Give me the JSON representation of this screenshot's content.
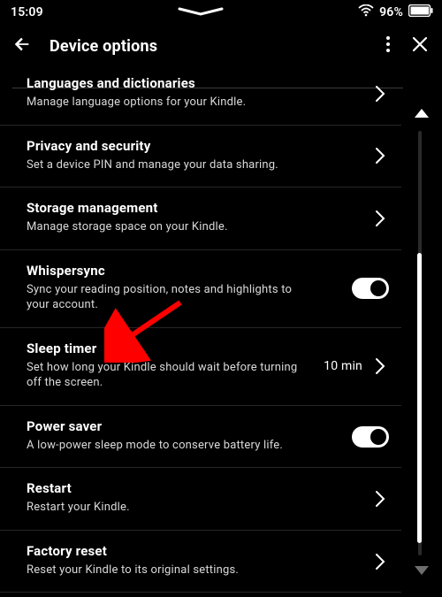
{
  "status_bar": {
    "time": "15:09",
    "battery": "96%"
  },
  "header": {
    "title": "Device options"
  },
  "rows": {
    "lang": {
      "title": "Languages and dictionaries",
      "sub": "Manage language options for your Kindle."
    },
    "priv": {
      "title": "Privacy and security",
      "sub": "Set a device PIN and manage your data sharing."
    },
    "stor": {
      "title": "Storage management",
      "sub": "Manage storage space on your Kindle."
    },
    "whis": {
      "title": "Whispersync",
      "sub": "Sync your reading position, notes and highlights to your account."
    },
    "sleep": {
      "title": "Sleep timer",
      "sub": "Set how long your Kindle should wait before turning off the screen.",
      "value": "10 min"
    },
    "power": {
      "title": "Power saver",
      "sub": "A low-power sleep mode to conserve battery life."
    },
    "rest": {
      "title": "Restart",
      "sub": "Restart your Kindle."
    },
    "fact": {
      "title": "Factory reset",
      "sub": "Reset your Kindle to its original settings."
    }
  }
}
